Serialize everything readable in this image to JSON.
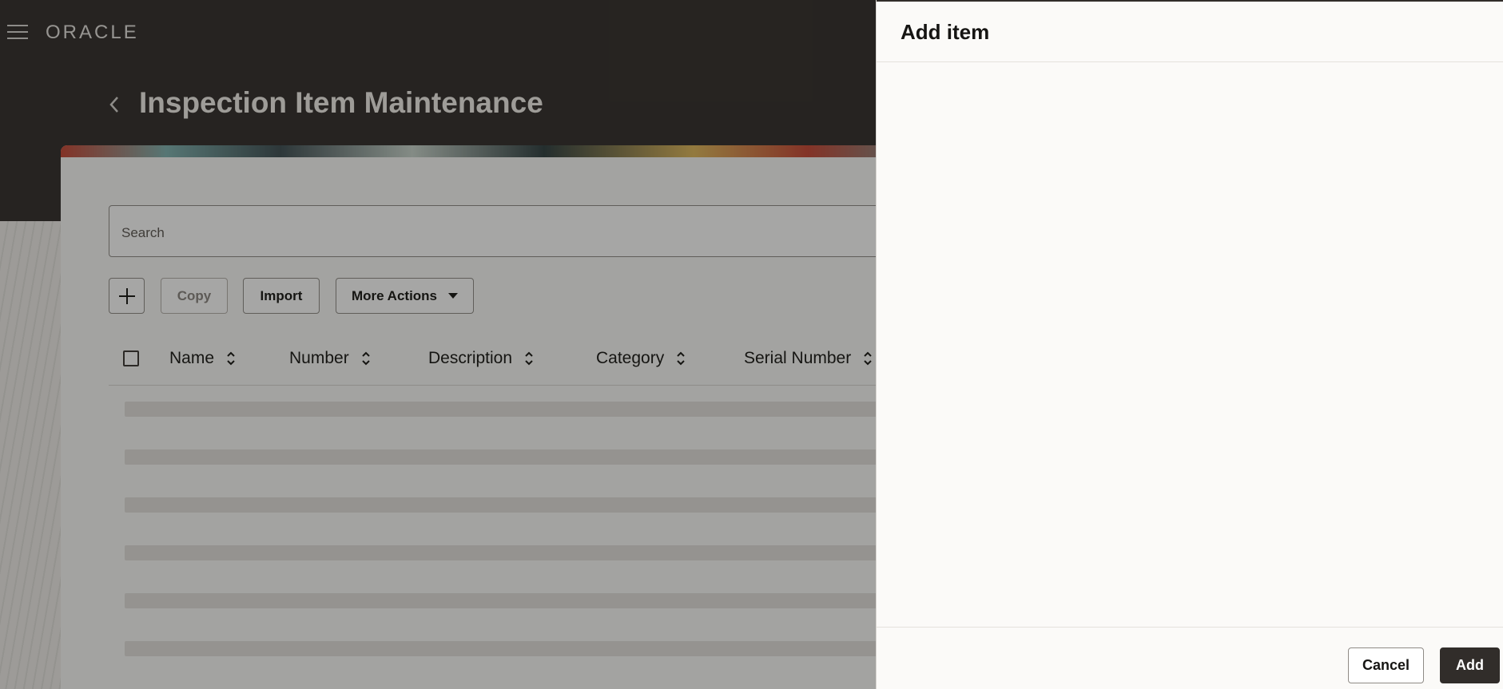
{
  "header": {
    "brand": "ORACLE",
    "menu_icon": "hamburger-menu-icon",
    "back_icon": "chevron-left-icon",
    "page_title": "Inspection Item Maintenance"
  },
  "search": {
    "placeholder": "Search"
  },
  "toolbar": {
    "add_icon": "plus-icon",
    "copy_label": "Copy",
    "import_label": "Import",
    "more_actions_label": "More Actions",
    "more_actions_icon": "caret-down-icon"
  },
  "table": {
    "columns": [
      "Name",
      "Number",
      "Description",
      "Category",
      "Serial Number"
    ],
    "sort_icon": "sort-arrows-icon",
    "loading_rows": 6
  },
  "drawer": {
    "title": "Add item",
    "cancel_label": "Cancel",
    "add_label": "Add"
  },
  "colors": {
    "header_bg": "#312d2a",
    "primary_button": "#312d2a",
    "page_bg": "#fbfaf8"
  }
}
